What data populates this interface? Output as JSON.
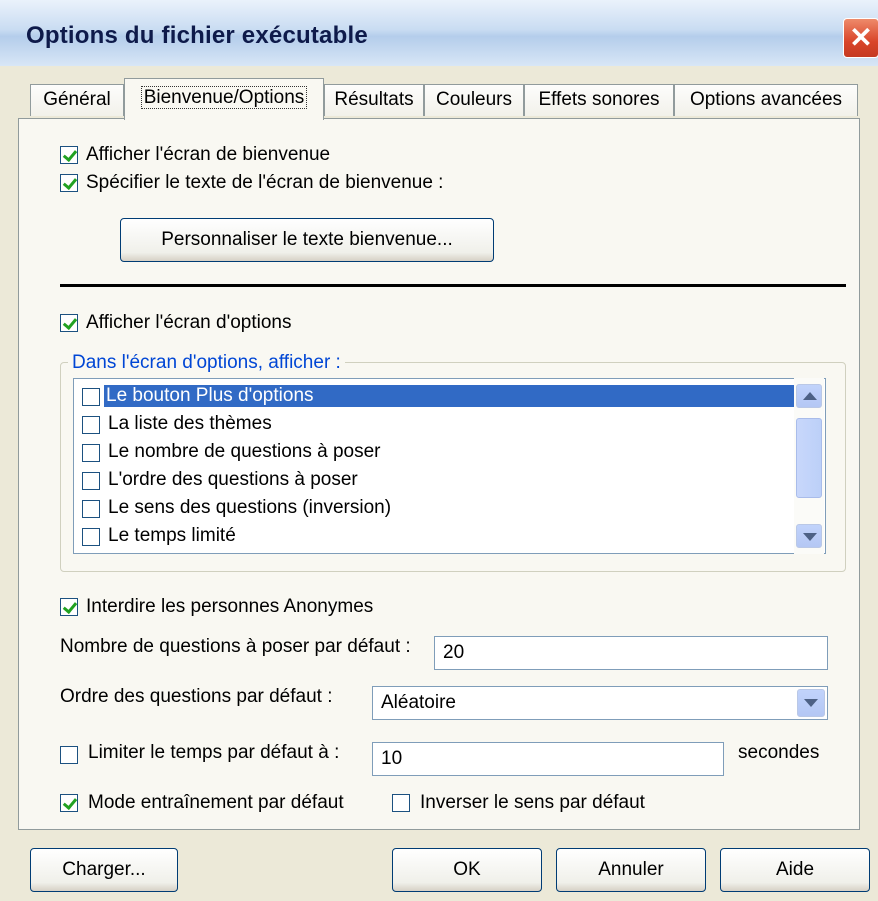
{
  "window": {
    "title": "Options du fichier exécutable",
    "close_symbol": "✕"
  },
  "tabs": [
    {
      "label": "Général"
    },
    {
      "label": "Bienvenue/Options"
    },
    {
      "label": "Résultats"
    },
    {
      "label": "Couleurs"
    },
    {
      "label": "Effets sonores"
    },
    {
      "label": "Options avancées"
    }
  ],
  "welcome": {
    "show_welcome": {
      "label": "Afficher l'écran de bienvenue",
      "checked": true
    },
    "custom_text": {
      "label": "Spécifier le texte de l'écran de bienvenue :",
      "checked": true
    },
    "customize_button": "Personnaliser le texte bienvenue..."
  },
  "options_screen": {
    "show_options": {
      "label": "Afficher l'écran d'options",
      "checked": true
    },
    "group_label": "Dans l'écran d'options, afficher :",
    "items": [
      {
        "label": "Le bouton Plus d'options",
        "checked": false,
        "selected": true
      },
      {
        "label": "La liste des thèmes",
        "checked": false
      },
      {
        "label": "Le nombre de questions à poser",
        "checked": false
      },
      {
        "label": "L'ordre des questions à poser",
        "checked": false
      },
      {
        "label": "Le sens des questions (inversion)",
        "checked": false
      },
      {
        "label": "Le temps limité",
        "checked": false
      }
    ]
  },
  "settings": {
    "forbid_anonymous": {
      "label": "Interdire les personnes Anonymes",
      "checked": true
    },
    "default_count_label": "Nombre de questions à poser par défaut :",
    "default_count_value": "20",
    "default_order_label": "Ordre des questions par défaut :",
    "default_order_value": "Aléatoire",
    "limit_time": {
      "label": "Limiter le temps par défaut à :",
      "checked": false
    },
    "limit_time_value": "10",
    "seconds_label": "secondes",
    "training_mode": {
      "label": "Mode entraînement par défaut",
      "checked": true
    },
    "invert_direction": {
      "label": "Inverser le sens par défaut",
      "checked": false
    }
  },
  "footer": {
    "load_button": "Charger...",
    "ok_button": "OK",
    "cancel_button": "Annuler",
    "help_button": "Aide"
  }
}
